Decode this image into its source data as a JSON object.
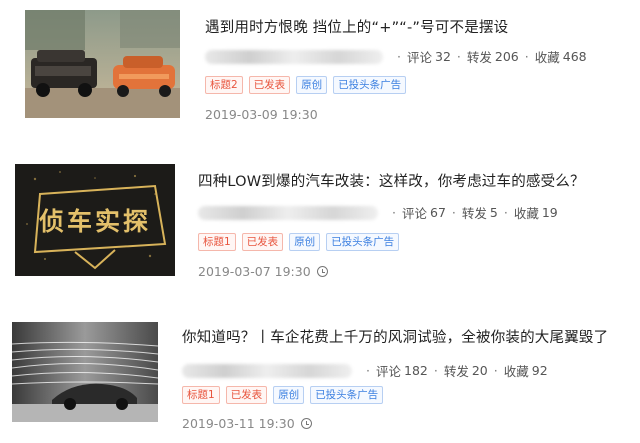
{
  "articles": [
    {
      "title": "遇到用时方恨晚 挡位上的“+”“-”号可不是摆设",
      "stats": {
        "comments_label": "评论",
        "comments": "32",
        "shares_label": "转发",
        "shares": "206",
        "favorites_label": "收藏",
        "favorites": "468"
      },
      "tags": [
        "标题2",
        "已发表",
        "原创",
        "已投头条广告"
      ],
      "date": "2019-03-09 19:30",
      "thumb_icon": "car-photo-icon"
    },
    {
      "title": "四种LOW到爆的汽车改装：这样改，你考虑过车的感受么？",
      "stats": {
        "comments_label": "评论",
        "comments": "67",
        "shares_label": "转发",
        "shares": "5",
        "favorites_label": "收藏",
        "favorites": "19"
      },
      "tags": [
        "标题1",
        "已发表",
        "原创",
        "已投头条广告"
      ],
      "date": "2019-03-07 19:30",
      "thumb_text": "侦车实探"
    },
    {
      "title": "你知道吗？丨车企花费上千万的风洞试验，全被你装的大尾翼毁了",
      "stats": {
        "comments_label": "评论",
        "comments": "182",
        "shares_label": "转发",
        "shares": "20",
        "favorites_label": "收藏",
        "favorites": "92"
      },
      "tags": [
        "标题1",
        "已发表",
        "原创",
        "已投头条广告"
      ],
      "date": "2019-03-11 19:30",
      "thumb_icon": "wind-tunnel-photo-icon"
    }
  ],
  "colors": {
    "tag_red": "#e8553e",
    "tag_blue": "#3b7fe0",
    "gold": "#d8b35a"
  }
}
